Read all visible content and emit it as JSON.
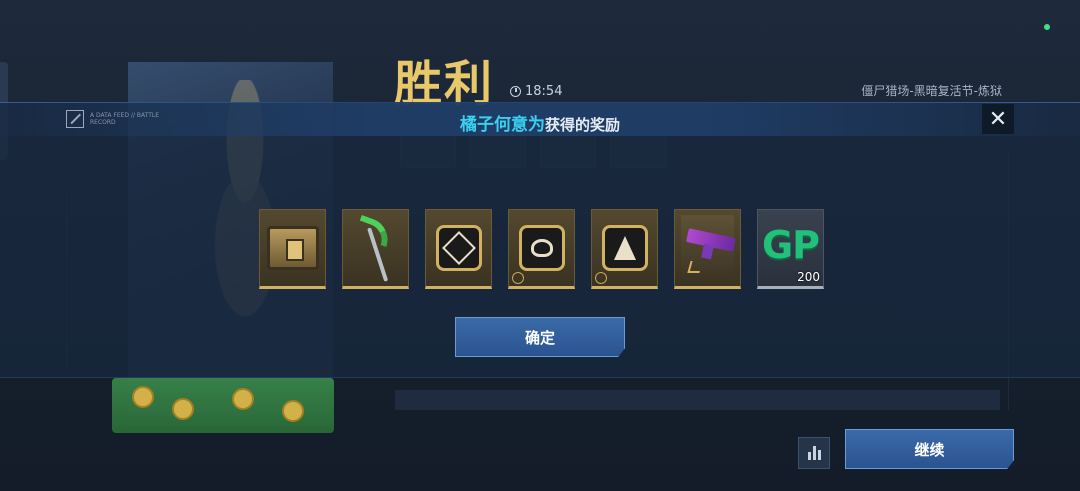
{
  "header": {
    "victory_title": "胜利",
    "match_time": "18:54",
    "mode_label": "僵尸猎场-黑暗复活节-炼狱"
  },
  "modal": {
    "player_name": "橘子何意为",
    "title_suffix": "获得的奖励",
    "close_symbol": "✕",
    "logo_text": "A DATA FEED // BATTLE RECORD",
    "rewards": [
      {
        "name": "supply-crate",
        "icon": "crate-icon",
        "rarity": "gold"
      },
      {
        "name": "green-scythe",
        "icon": "scythe-icon",
        "rarity": "gold"
      },
      {
        "name": "diamond-emblem",
        "icon": "emblem-diamond-icon",
        "rarity": "gold"
      },
      {
        "name": "horned-emblem",
        "icon": "emblem-horned-icon",
        "rarity": "gold"
      },
      {
        "name": "spike-emblem",
        "icon": "emblem-spike-icon",
        "rarity": "gold"
      },
      {
        "name": "purple-gun",
        "icon": "gun-icon",
        "rarity": "gold"
      },
      {
        "name": "gp-points",
        "icon": "gp-icon",
        "rarity": "gray",
        "label": "GP",
        "count": "200"
      }
    ],
    "confirm_label": "确定"
  },
  "footer": {
    "continue_label": "继续",
    "stats_icon": "bar-chart-icon"
  },
  "colors": {
    "accent_gold": "#e8c86a",
    "player_name": "#3ad0f0",
    "button_blue": "#2a5490",
    "gp_green": "#22c07a",
    "status_dot": "#3fe08a"
  }
}
